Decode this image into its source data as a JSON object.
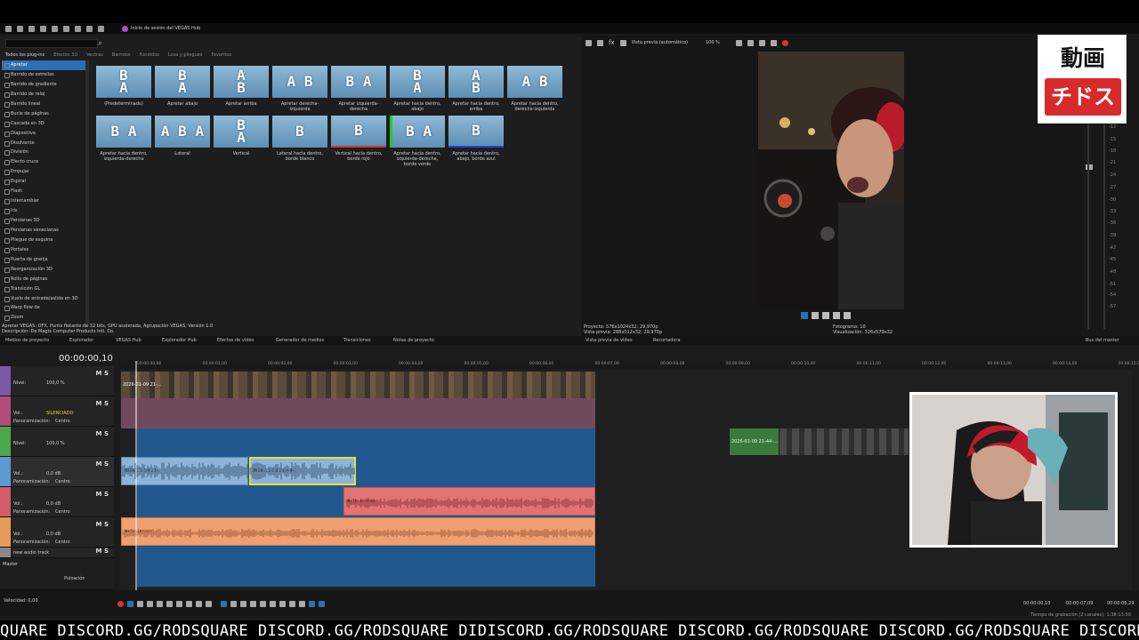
{
  "topbar": {
    "hub_label": "Inicio de sesión del VEGAS Hub"
  },
  "transitions": {
    "tabs": [
      "Todos los plug-ins",
      "Efectos 3D",
      "Vectras",
      "Barridos",
      "Fundidos",
      "Losa y pliegues",
      "Favoritos"
    ],
    "list": [
      "Apretar",
      "Barrido de estrellas",
      "Barrido de gradiente",
      "Barrido de reloj",
      "Barrido lineal",
      "Bucle de páginas",
      "Cascada en 3D",
      "Diapositiva",
      "Disolvente",
      "División",
      "Efecto cruce",
      "Empujar",
      "Espiral",
      "Flash",
      "Intercambiar",
      "Iris",
      "Persianas 3D",
      "Persianas venecianas",
      "Pliegue de esquina",
      "Portales",
      "Puerta de granja",
      "Reorganización 3D",
      "Rollo de páginas",
      "Transición GL",
      "Vuelo de entrada/salida en 3D",
      "Warp flow de",
      "Zoom"
    ],
    "presets": [
      {
        "glyph": "B\nA",
        "label": "(Predeterminado)"
      },
      {
        "glyph": "B\nA",
        "label": "Apretar abajo"
      },
      {
        "glyph": "A\nB",
        "label": "Apretar arriba"
      },
      {
        "glyph": "A B",
        "label": "Apretar derecha-izquierda"
      },
      {
        "glyph": "B A",
        "label": "Apretar izquierda-derecha"
      },
      {
        "glyph": "B\nA",
        "label": "Apretar hacia dentro, abajo"
      },
      {
        "glyph": "A\nB",
        "label": "Apretar hacia dentro, arriba"
      },
      {
        "glyph": "A B",
        "label": "Apretar hacia dentro, derecha-izquierda"
      },
      {
        "glyph": "B A",
        "label": "Apretar hacia dentro, izquierda-derecha"
      },
      {
        "glyph": "A B A",
        "label": "Lateral"
      },
      {
        "glyph": "B\nA",
        "label": "Vertical"
      },
      {
        "glyph": "B",
        "label": "Lateral hacia dentro, borde blanco"
      },
      {
        "glyph": "B",
        "label": "Vertical hacia dentro, borde rojo"
      },
      {
        "glyph": "B A",
        "label": "Apretar hacia dentro, izquierda-derecha, borde verde"
      },
      {
        "glyph": "B",
        "label": "Apretar hacia dentro, abajo, borde azul"
      }
    ],
    "status1": "Apretar VEGAS: OFX, Punto flotante de 32 bits, GPU acelerada, Agrupación VEGAS, Versión 1.0",
    "status2": "Descripción: De Magix Computer Products Intl. Co."
  },
  "panel_tabs": [
    "Medios de proyecto",
    "Explorador",
    "VEGAS Hub",
    "Explorador Hub",
    "Efectos de vídeo",
    "Generador de medios",
    "Transiciones",
    "Notas de proyecto",
    "Vista previa de vídeo",
    "Recortadora",
    "Bus del master"
  ],
  "preview": {
    "mode": "Vista previa (automático)",
    "zoom": "100 %",
    "info_left_1": "Proyecto:     576x1024x32; 29,970p",
    "info_left_2": "Vista previa:   288x512x32; 29,970p",
    "info_right_1": "Fotograma:     10",
    "info_right_2": "Visualización:  326x579x32"
  },
  "logo": {
    "line1": "動画",
    "line2": "チドス"
  },
  "timeline": {
    "timecode": "00:00:00,10",
    "ruler": [
      "00:00:00,00",
      "00:00:01,00",
      "00:00:02,00",
      "00:00:03,00",
      "00:00:04,00",
      "00:00:05,00",
      "00:00:06,00",
      "00:00:07,00",
      "00:00:08,00",
      "00:00:09,00",
      "00:00:10,00",
      "00:00:11,00",
      "00:00:12,00",
      "00:00:13,00",
      "00:00:14,00",
      "00:00:15,00"
    ],
    "tracks": [
      {
        "label": "Nivel:",
        "value": "100,0 %",
        "color": "#7b5aa6"
      },
      {
        "label": "Vol.:",
        "value": "SILENCIADO",
        "pan": "Centro",
        "color": "#b14c7a"
      },
      {
        "label": "Nivel:",
        "value": "100,0 %",
        "color": "#4da84d"
      },
      {
        "label": "Vol.:",
        "value": "0,0 dB",
        "pan": "Centro",
        "color": "#5a9bd1"
      },
      {
        "label": "Vol.:",
        "value": "0,0 dB",
        "pan": "Centro",
        "color": "#d35b6a"
      },
      {
        "label": "Vol.:",
        "value": "0,0 dB",
        "pan": "Centro",
        "color": "#e69a5a"
      },
      {
        "label": "new audio track",
        "value": "",
        "color": "#888"
      }
    ],
    "pan_label": "Panoramización:",
    "master": "Master",
    "pulsacion": "Pulsación",
    "velocidad": "Velocidad: 0,00",
    "clip_labels": [
      "2026-01-09 21-...",
      "2026-01-09 21-44-...",
      "audio (vocal)",
      "audio (music)",
      "2026-01-09 21-44-..."
    ],
    "time1": "00:00:00,10",
    "time2": "00:00:07,09",
    "time3": "00:00:06,29",
    "rec": "Tiempo de grabación (2 canales): 1:38:13:30"
  },
  "ticker": "QUARE DISCORD.GG/RODSQUARE DISCORD.GG/RODSQUARE DIDISCORD.GG/RODSQUARE DISCORD.GG/RODSQUARE DISCORD.GG/RODSQUARE DISCORD.GG/RODSQUARE"
}
